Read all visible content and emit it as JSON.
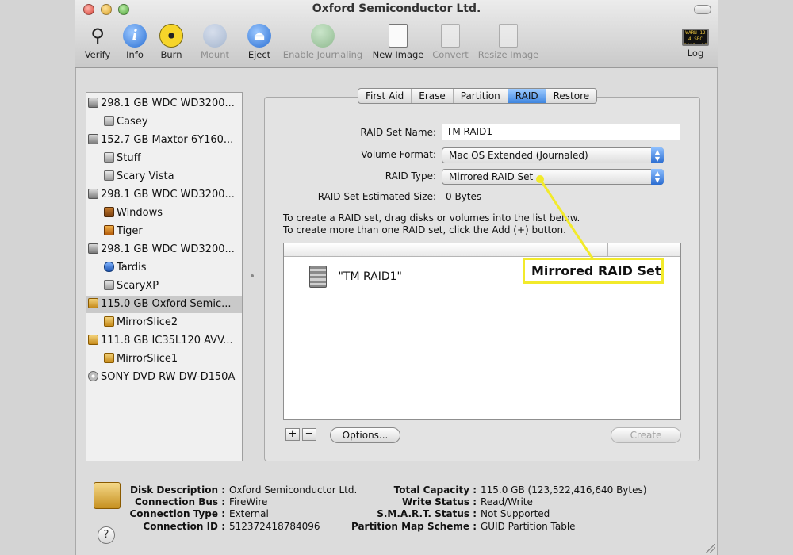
{
  "window": {
    "title": "Oxford Semiconductor Ltd."
  },
  "toolbar": {
    "verify": "Verify",
    "info": "Info",
    "burn": "Burn",
    "mount": "Mount",
    "eject": "Eject",
    "enable_journaling": "Enable Journaling",
    "new_image": "New Image",
    "convert": "Convert",
    "resize_image": "Resize Image",
    "log": "Log"
  },
  "sidebar": {
    "items": [
      {
        "label": "298.1 GB WDC WD3200...",
        "icon": "hard-disk-icon"
      },
      {
        "label": "Casey",
        "icon": "volume-icon"
      },
      {
        "label": "152.7 GB Maxtor 6Y160...",
        "icon": "hard-disk-icon"
      },
      {
        "label": "Stuff",
        "icon": "volume-icon"
      },
      {
        "label": "Scary Vista",
        "icon": "volume-icon"
      },
      {
        "label": "298.1 GB WDC WD3200...",
        "icon": "hard-disk-icon"
      },
      {
        "label": "Windows",
        "icon": "windows-volume-icon"
      },
      {
        "label": "Tiger",
        "icon": "tiger-volume-icon"
      },
      {
        "label": "298.1 GB WDC WD3200...",
        "icon": "hard-disk-icon"
      },
      {
        "label": "Tardis",
        "icon": "tardis-volume-icon"
      },
      {
        "label": "ScaryXP",
        "icon": "volume-icon"
      },
      {
        "label": "115.0 GB Oxford Semic...",
        "icon": "firewire-disk-icon"
      },
      {
        "label": "MirrorSlice2",
        "icon": "firewire-volume-icon"
      },
      {
        "label": "111.8 GB IC35L120 AVV...",
        "icon": "firewire-disk-icon"
      },
      {
        "label": "MirrorSlice1",
        "icon": "firewire-volume-icon"
      },
      {
        "label": "SONY DVD RW DW-D150A",
        "icon": "optical-drive-icon"
      }
    ],
    "selected_index": 11
  },
  "tabs": [
    "First Aid",
    "Erase",
    "Partition",
    "RAID",
    "Restore"
  ],
  "active_tab": "RAID",
  "raid": {
    "set_name_label": "RAID Set Name:",
    "set_name_value": "TM RAID1",
    "volume_format_label": "Volume Format:",
    "volume_format_value": "Mac OS Extended (Journaled)",
    "raid_type_label": "RAID Type:",
    "raid_type_value": "Mirrored RAID Set",
    "estimated_size_label": "RAID Set Estimated Size:",
    "estimated_size_value": "0 Bytes",
    "instruction_1": "To create a RAID set, drag disks or volumes into the list below.",
    "instruction_2": "To create more than one RAID set, click the Add (+) button.",
    "list_item": "\"TM RAID1\"",
    "add_label": "+",
    "remove_label": "−",
    "options_label": "Options...",
    "create_label": "Create"
  },
  "callout": {
    "text": "Mirrored RAID Set",
    "color": "#f2ea2b"
  },
  "info": {
    "disk_description_label": "Disk Description :",
    "disk_description_value": "Oxford Semiconductor Ltd.",
    "connection_bus_label": "Connection Bus :",
    "connection_bus_value": "FireWire",
    "connection_type_label": "Connection Type :",
    "connection_type_value": "External",
    "connection_id_label": "Connection ID :",
    "connection_id_value": "512372418784096",
    "total_capacity_label": "Total Capacity :",
    "total_capacity_value": "115.0 GB (123,522,416,640 Bytes)",
    "write_status_label": "Write Status :",
    "write_status_value": "Read/Write",
    "smart_status_label": "S.M.A.R.T. Status :",
    "smart_status_value": "Not Supported",
    "partition_map_label": "Partition Map Scheme :",
    "partition_map_value": "GUID Partition Table",
    "help_label": "?"
  }
}
